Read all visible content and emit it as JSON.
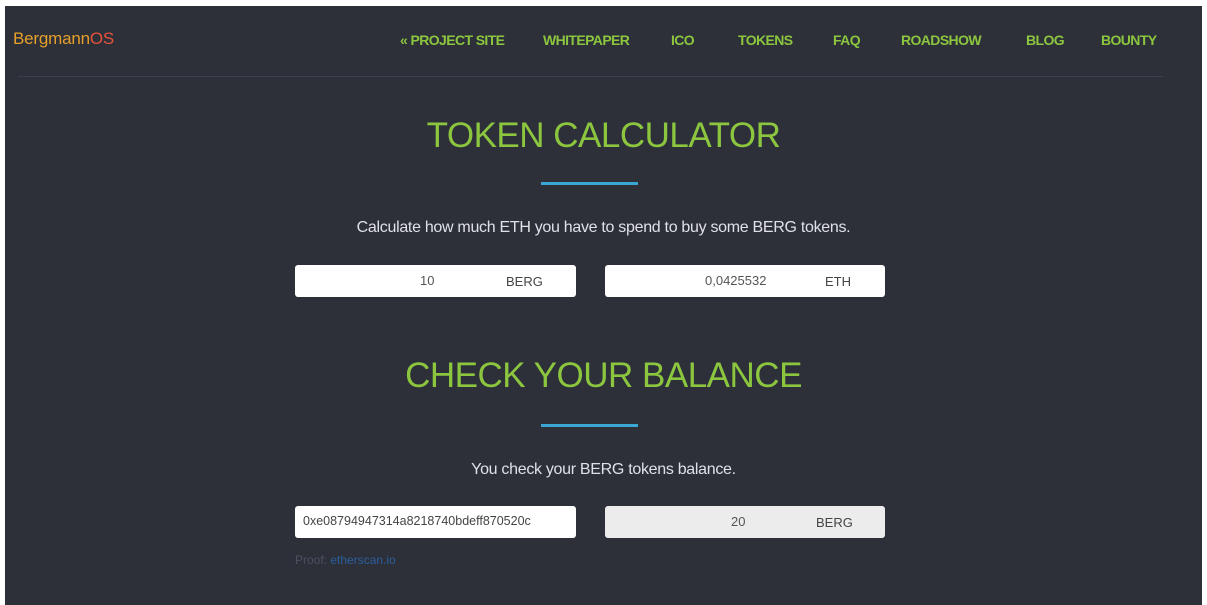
{
  "brand": {
    "part1": "Bergmann",
    "part2": "OS"
  },
  "nav": {
    "items": [
      {
        "label": "« PROJECT SITE",
        "name": "nav-project-site"
      },
      {
        "label": "WHITEPAPER",
        "name": "nav-whitepaper"
      },
      {
        "label": "ICO",
        "name": "nav-ico"
      },
      {
        "label": "TOKENS",
        "name": "nav-tokens"
      },
      {
        "label": "FAQ",
        "name": "nav-faq"
      },
      {
        "label": "ROADSHOW",
        "name": "nav-roadshow"
      },
      {
        "label": "BLOG",
        "name": "nav-blog"
      },
      {
        "label": "BOUNTY",
        "name": "nav-bounty"
      }
    ]
  },
  "calculator": {
    "title": "TOKEN CALCULATOR",
    "description": "Calculate how much ETH you have to spend to buy some BERG tokens.",
    "token_amount": "10",
    "token_unit": "BERG",
    "eth_amount": "0,0425532",
    "eth_unit": "ETH"
  },
  "balance": {
    "title": "CHECK YOUR BALANCE",
    "description": "You check your BERG tokens balance.",
    "address": "0xe08794947314a8218740bdeff870520c",
    "amount": "20",
    "unit": "BERG",
    "proof_label": "Proof:",
    "proof_link": "etherscan.io"
  },
  "colors": {
    "background": "#2d3039",
    "accent_green": "#8cc63f",
    "accent_blue": "#3aa6d3",
    "brand_orange": "#e6a02a",
    "brand_red": "#e8513a"
  }
}
